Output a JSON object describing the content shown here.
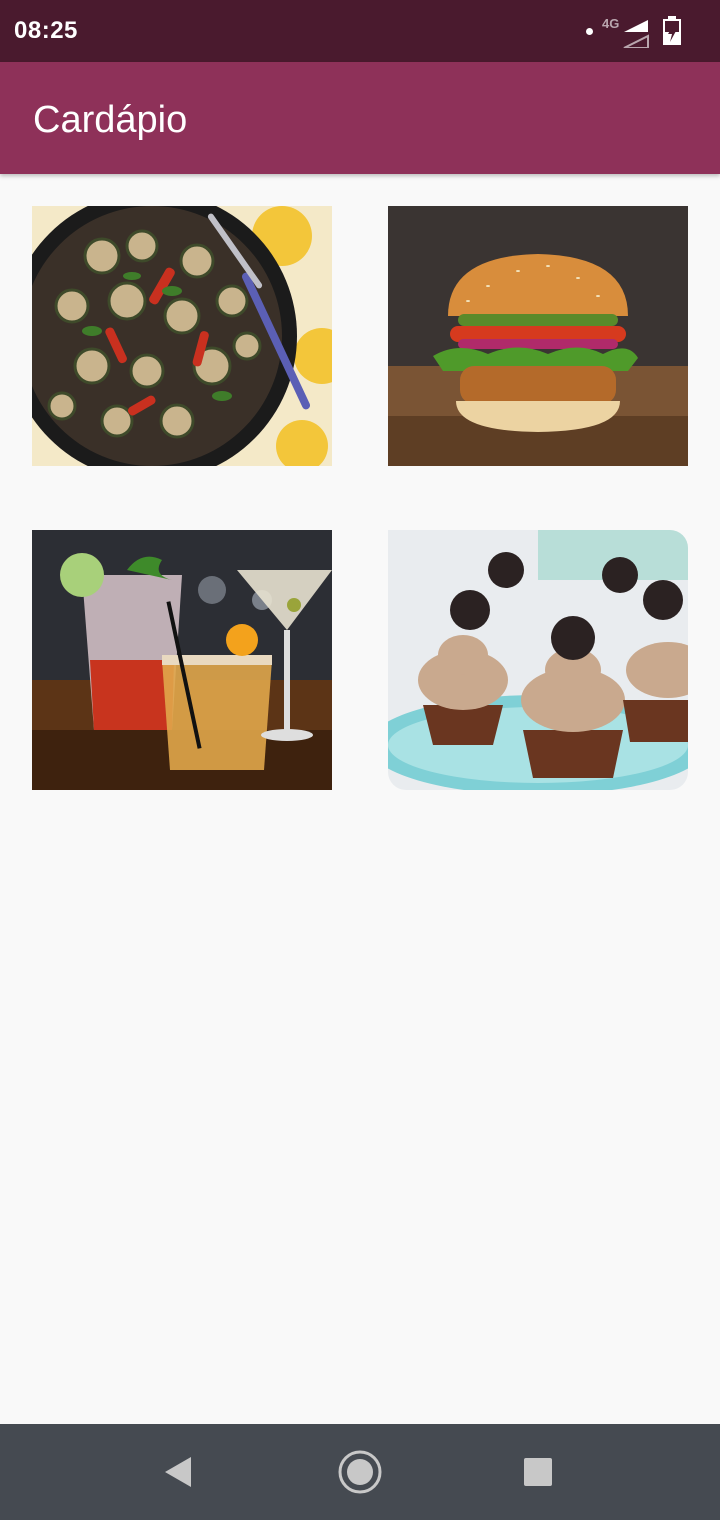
{
  "status_bar": {
    "time": "08:25",
    "network_label": "4G",
    "icons": [
      "notification-dot-icon",
      "signal-icon",
      "battery-icon"
    ]
  },
  "app_bar": {
    "title": "Cardápio",
    "color": "#8e3159"
  },
  "menu_items": [
    {
      "image": "grilled-vegetables-photo"
    },
    {
      "image": "burger-photo"
    },
    {
      "image": "cocktails-photo"
    },
    {
      "image": "cupcakes-photo"
    }
  ],
  "nav_bar": {
    "buttons": [
      "back-icon",
      "home-icon",
      "recent-apps-icon"
    ]
  }
}
